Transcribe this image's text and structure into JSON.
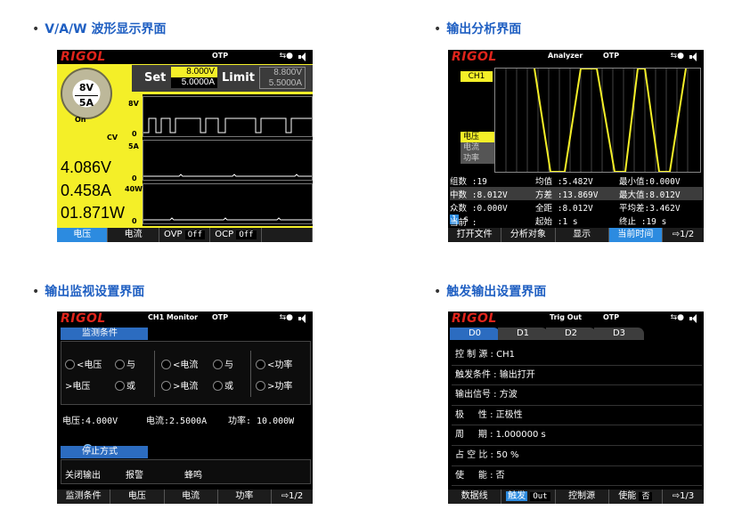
{
  "captions": {
    "c1": "V/A/W 波形显示界面",
    "c2": "输出分析界面",
    "c3": "输出监视设置界面",
    "c4": "触发输出设置界面"
  },
  "brand": "RIGOL",
  "screen1": {
    "otp": "OTP",
    "dial_v": "8V",
    "dial_a": "5A",
    "on": "On",
    "set_label": "Set",
    "set_v": "8.000V",
    "set_a": "5.0000A",
    "limit_label": "Limit",
    "limit_v": "8.800V",
    "limit_a": "5.5000A",
    "wave_labels": {
      "v_top": "8V",
      "cv": "CV",
      "zero1": "0",
      "a_top": "5A",
      "zero2": "0",
      "w_top": "40W",
      "zero3": "0"
    },
    "voltage": "4.086V",
    "current": "0.458A",
    "power": "01.871W",
    "softkeys": {
      "k1": "电压",
      "k2": "电流",
      "ovp": "OVP",
      "ovp_val": "Off",
      "ocp": "OCP",
      "ocp_val": "Off"
    }
  },
  "screen2": {
    "title": "Analyzer",
    "otp": "OTP",
    "channel": "CH1",
    "modes": [
      "电压",
      "电流",
      "功率"
    ],
    "stats": {
      "r1": [
        "组数 :19",
        "均值 :5.482V",
        "最小值:0.000V"
      ],
      "r2": [
        "中数 :8.012V",
        "方差 :13.869V",
        "最大值:8.012V"
      ],
      "r3": [
        "众数 :0.000V",
        "全距 :8.012V",
        "平均差:3.462V"
      ],
      "r4_a": "当前 :",
      "r4_a_val": "1",
      "r4_a_unit": " s",
      "r4_b": "起始 :1 s",
      "r4_c": "终止 :19 s"
    },
    "softkeys": {
      "k1": "打开文件",
      "k2": "分析对象",
      "k3": "显示",
      "k4": "当前时间",
      "page": "⇨1/2"
    }
  },
  "screen3": {
    "title": "CH1 Monitor",
    "otp": "OTP",
    "section1": "监测条件",
    "opts": {
      "a1": "<电压",
      "a2": "与",
      "a3": "<电流",
      "a4": "与",
      "a5": "<功率",
      "b1": ">电压",
      "b2": "或",
      "b3": ">电流",
      "b4": "或",
      "b5": ">功率"
    },
    "readings": {
      "v": "电压:4.000V",
      "a": "电流:2.5000A",
      "p": "功率: 10.000W"
    },
    "section2": "停止方式",
    "stop": {
      "o1": "关闭输出",
      "o2": "报警",
      "o3": "蜂鸣"
    },
    "softkeys": {
      "k1": "监测条件",
      "k2": "电压",
      "k3": "电流",
      "k4": "功率",
      "page": "⇨1/2"
    }
  },
  "screen4": {
    "title": "Trig Out",
    "otp": "OTP",
    "tabs": [
      "D0",
      "D1",
      "D2",
      "D3"
    ],
    "rows": [
      "控 制 源 : CH1",
      "触发条件 : 输出打开",
      "输出信号 : 方波",
      "极     性 : 正极性",
      "周     期 : 1.000000 s",
      "占 空 比 : 50 %",
      "使     能 : 否"
    ],
    "softkeys": {
      "k1": "数据线",
      "k2": "触发",
      "k2_val": "Out",
      "k3": "控制源",
      "k4": "使能",
      "k4_val": "否",
      "page": "⇨1/3"
    }
  },
  "colors": {
    "accent_blue": "#2c8be0",
    "screen_yellow": "#f4ef28",
    "brand_red": "#e0241b",
    "caption_blue": "#1f5fc2"
  }
}
